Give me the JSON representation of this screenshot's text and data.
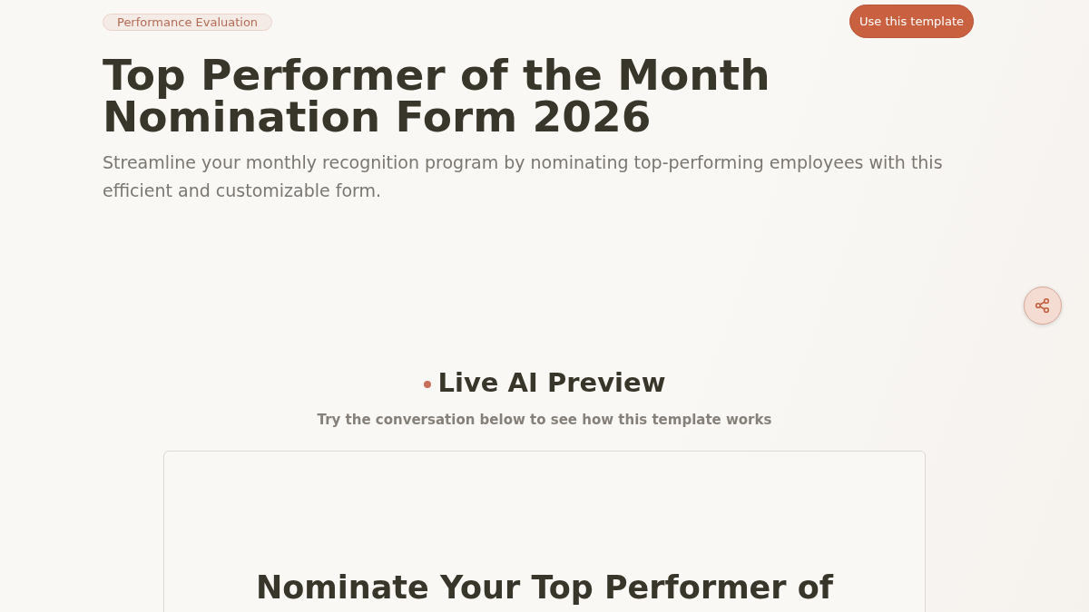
{
  "header": {
    "category": "Performance Evaluation",
    "cta_button": "Use this template"
  },
  "title": "Top Performer of the Month Nomination Form 2026",
  "description": "Streamline your monthly recognition program by nominating top-performing employees with this efficient and customizable form.",
  "preview": {
    "heading": "Live AI Preview",
    "subheading": "Try the conversation below to see how this template works",
    "form_title": "Nominate Your Top Performer of"
  }
}
